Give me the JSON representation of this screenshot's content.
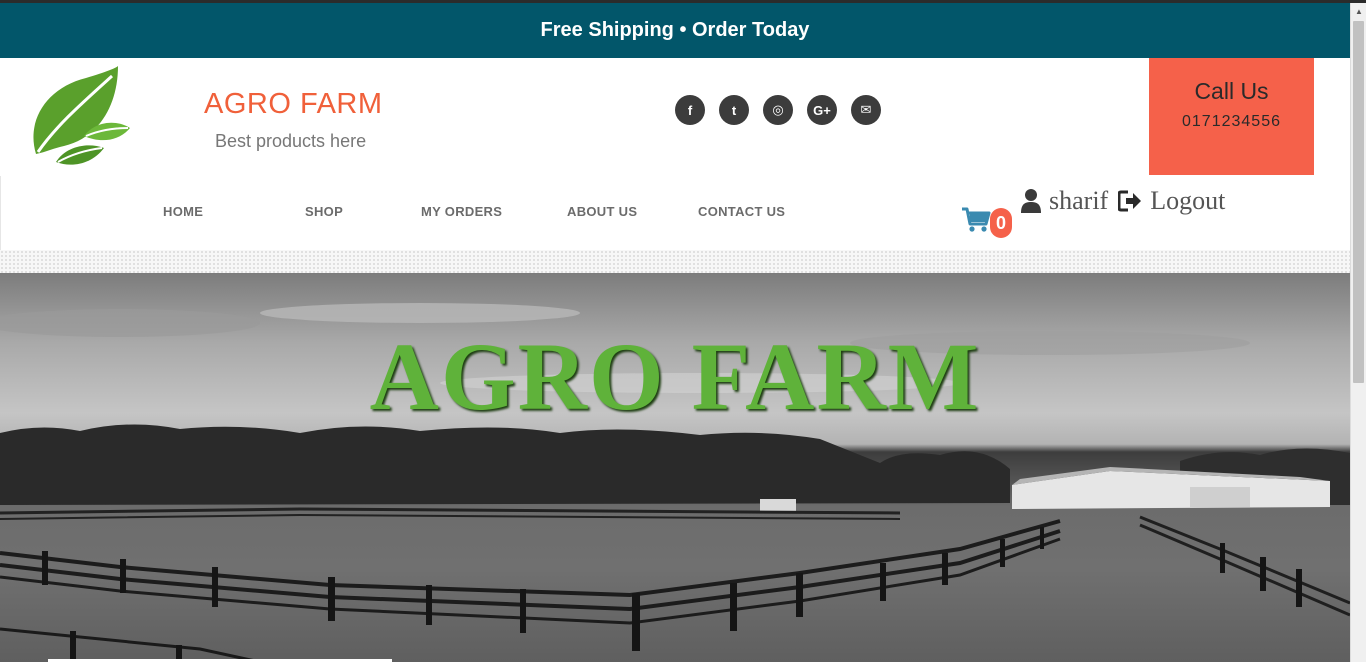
{
  "promo": {
    "text": "Free Shipping • Order Today"
  },
  "brand": {
    "name": "AGRO FARM",
    "tagline": "Best products here",
    "logo": "leaf-logo-icon"
  },
  "social": [
    {
      "icon": "facebook-icon",
      "glyph": "f"
    },
    {
      "icon": "twitter-icon",
      "glyph": "t"
    },
    {
      "icon": "instagram-icon",
      "glyph": "◎"
    },
    {
      "icon": "google-plus-icon",
      "glyph": "G+"
    },
    {
      "icon": "envelope-icon",
      "glyph": "✉"
    }
  ],
  "call": {
    "title": "Call Us",
    "number": "0171234556"
  },
  "nav": {
    "items": [
      "HOME",
      "SHOP",
      "MY ORDERS",
      "ABOUT US",
      "CONTACT US"
    ]
  },
  "cart": {
    "count": "0",
    "icon": "cart-icon"
  },
  "user": {
    "name": "sharif",
    "logout_label": "Logout"
  },
  "hero": {
    "title": "AGRO FARM"
  },
  "colors": {
    "promo_bg": "#02566a",
    "accent": "#f5614a",
    "brand_text": "#f0603a",
    "hero_title": "#5fb23a"
  }
}
